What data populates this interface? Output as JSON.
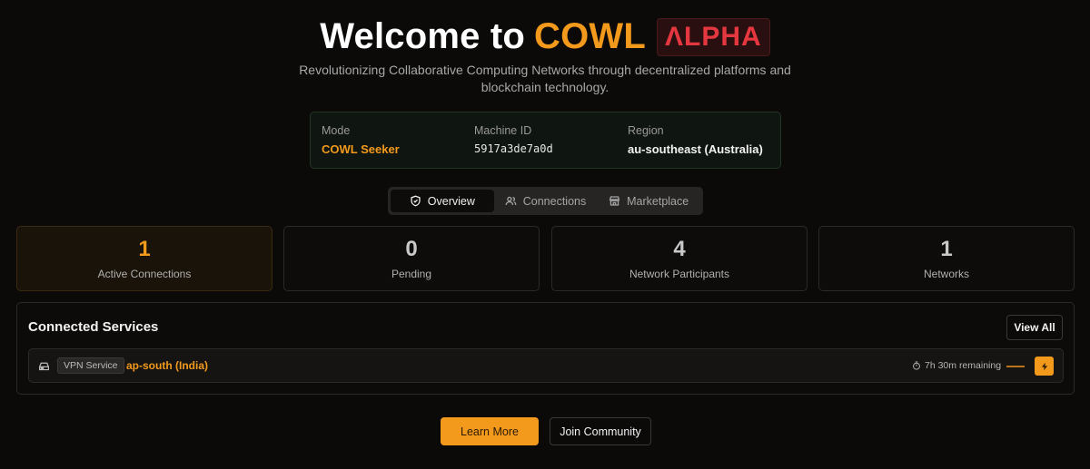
{
  "hero": {
    "title_prefix": "Welcome to",
    "brand": "COWL",
    "badge": "ΛLPHA",
    "subtitle": "Revolutionizing Collaborative Computing Networks through decentralized platforms and blockchain technology."
  },
  "info": {
    "mode_label": "Mode",
    "mode_value": "COWL Seeker",
    "machine_label": "Machine ID",
    "machine_value": "5917a3de7a0d",
    "region_label": "Region",
    "region_value": "au-southeast (Australia)"
  },
  "tabs": [
    {
      "label": "Overview",
      "icon": "shield-icon",
      "active": true
    },
    {
      "label": "Connections",
      "icon": "users-icon",
      "active": false
    },
    {
      "label": "Marketplace",
      "icon": "store-icon",
      "active": false
    }
  ],
  "stats": [
    {
      "value": "1",
      "label": "Active Connections",
      "highlight": true
    },
    {
      "value": "0",
      "label": "Pending",
      "highlight": false
    },
    {
      "value": "4",
      "label": "Network Participants",
      "highlight": false
    },
    {
      "value": "1",
      "label": "Networks",
      "highlight": false
    }
  ],
  "services": {
    "title": "Connected Services",
    "view_all": "View All",
    "items": [
      {
        "icon": "server-icon",
        "type": "VPN Service",
        "region": "ap-south (India)",
        "remaining": "7h 30m remaining",
        "progress_fraction": 1.0,
        "action_icon": "bolt-icon"
      }
    ]
  },
  "actions": {
    "learn_more": "Learn More",
    "join_community": "Join Community"
  },
  "colors": {
    "accent": "#f39a1c",
    "alpha_badge": "#e5373f",
    "background": "#0b0a09"
  }
}
